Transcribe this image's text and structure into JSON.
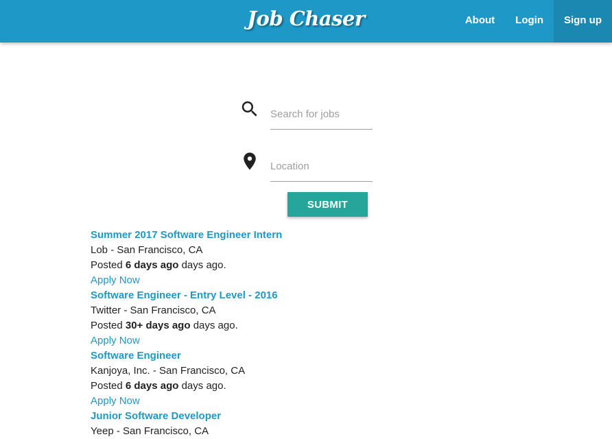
{
  "nav": {
    "brand": "Job Chaser",
    "links": [
      {
        "label": "About"
      },
      {
        "label": "Login"
      },
      {
        "label": "Sign up"
      }
    ]
  },
  "search": {
    "query_placeholder": "Search for jobs",
    "query_value": "",
    "location_placeholder": "Location",
    "location_value": "",
    "submit_label": "SUBMIT",
    "search_icon": "magnifier-icon",
    "location_icon": "map-pin-icon"
  },
  "jobs": [
    {
      "title": "Summer 2017 Software Engineer Intern",
      "company_location": "Lob - San Francisco, CA",
      "posted_prefix": "Posted",
      "posted_age": "6 days ago",
      "posted_suffix": "days ago.",
      "apply_label": "Apply Now"
    },
    {
      "title": "Software Engineer - Entry Level - 2016",
      "company_location": "Twitter - San Francisco, CA",
      "posted_prefix": "Posted",
      "posted_age": "30+ days ago",
      "posted_suffix": "days ago.",
      "apply_label": "Apply Now"
    },
    {
      "title": "Software Engineer",
      "company_location": "Kanjoya, Inc. - San Francisco, CA",
      "posted_prefix": "Posted",
      "posted_age": "6 days ago",
      "posted_suffix": "days ago.",
      "apply_label": "Apply Now"
    },
    {
      "title": "Junior Software Developer",
      "company_location": "Yeep - San Francisco, CA"
    }
  ],
  "colors": {
    "navbar": "#1e98c6",
    "link": "#1e98c6",
    "button": "#26a69a"
  }
}
